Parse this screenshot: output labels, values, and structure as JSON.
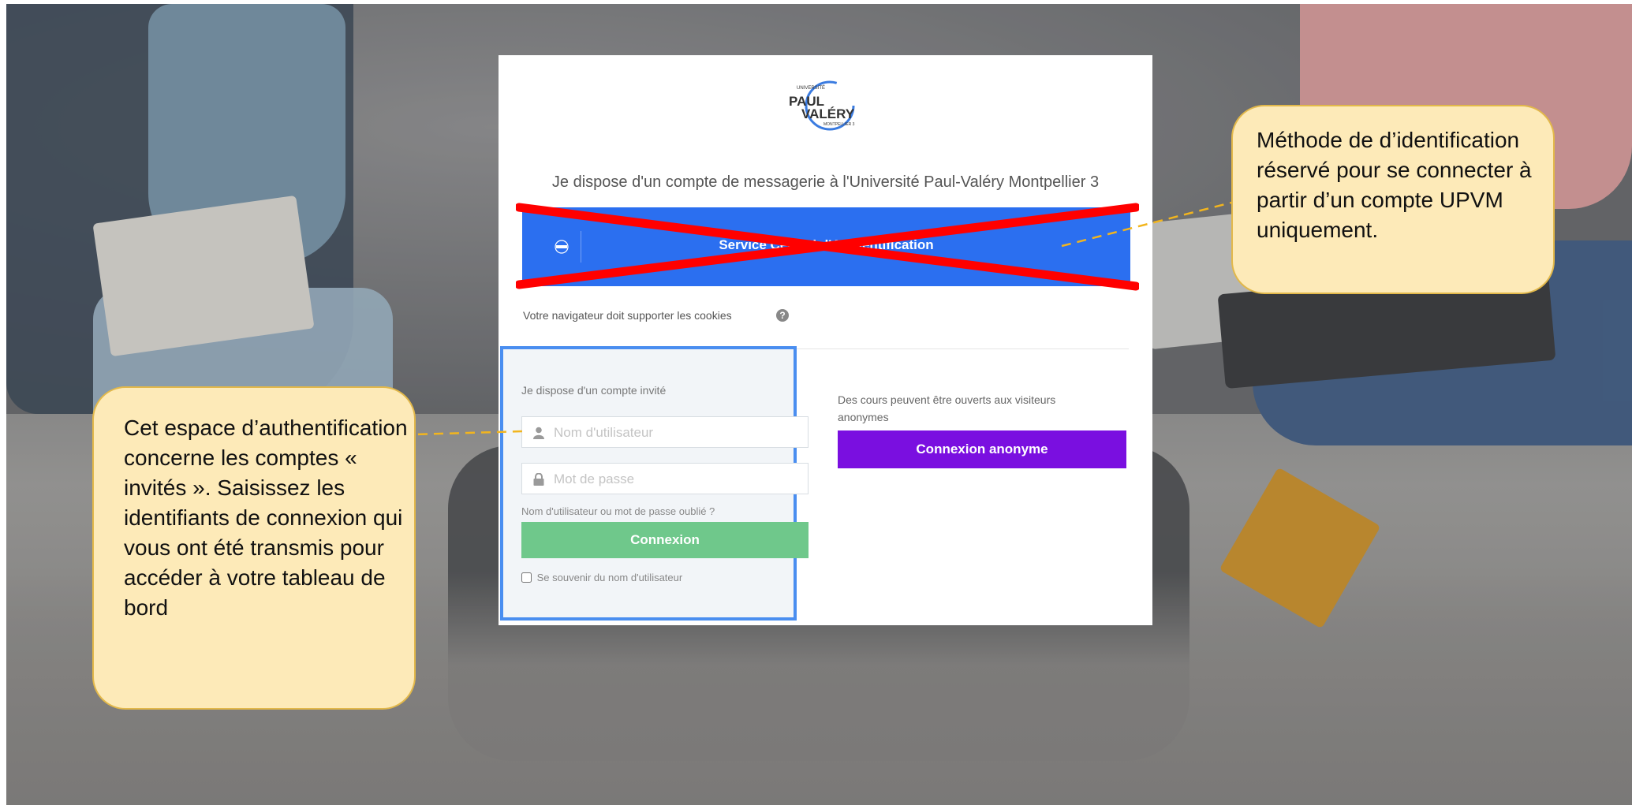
{
  "logo": {
    "top_text": "UNIVERSITÉ",
    "line1": "PAUL",
    "line2": "VALÉRY",
    "bottom_text": "MONTPELLIER 3"
  },
  "login": {
    "heading": "Je dispose d'un compte de messagerie à l'Université Paul-Valéry Montpellier 3",
    "cas_button_label": "Service Central d'Authentification",
    "cookies_notice": "Votre navigateur doit supporter les cookies",
    "guest_title": "Je dispose d'un compte invité",
    "username_placeholder": "Nom d'utilisateur",
    "password_placeholder": "Mot de passe",
    "forgot_link": "Nom d'utilisateur ou mot de passe oublié ?",
    "login_button": "Connexion",
    "remember_label": "Se souvenir du nom d'utilisateur",
    "anonymous_text": "Des cours peuvent être ouverts aux visiteurs anonymes",
    "anonymous_button": "Connexion anonyme"
  },
  "callouts": {
    "right": "Méthode de d’identification réservé pour se connecter à partir d’un compte UPVM uniquement.",
    "left": "Cet espace d’authentification concerne les comptes « invités ». Saisissez les identifiants de connexion qui vous ont été transmis pour accéder à votre tableau de bord"
  },
  "colors": {
    "cas_blue": "#2b6ff0",
    "cross_red": "#ff0000",
    "login_green": "#6fc88b",
    "anonymous_purple": "#7a0fe0",
    "callout_fill": "#fdeab8",
    "callout_border": "#e2b84a",
    "guest_highlight_border": "#4a8ef0"
  },
  "icons": {
    "help": "question-circle-icon",
    "username": "user-icon",
    "password": "lock-icon"
  }
}
